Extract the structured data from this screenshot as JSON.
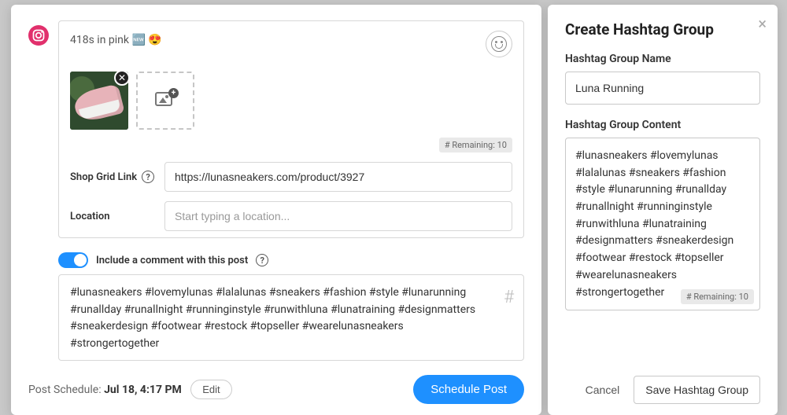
{
  "compose": {
    "caption_text": "418s in pink 🆕  😍",
    "media_remaining": "# Remaining: 10",
    "shop_grid_label": "Shop Grid Link",
    "shop_grid_value": "https://lunasneakers.com/product/3927",
    "location_label": "Location",
    "location_placeholder": "Start typing a location...",
    "include_comment_label": "Include a comment with this post",
    "comment_text": "#lunasneakers #lovemylunas #lalalunas #sneakers #fashion #style #lunarunning #runallday #runallnight #runninginstyle #runwithluna #lunatraining #designmatters #sneakerdesign #footwear #restock #topseller #wearelunasneakers #strongertogether"
  },
  "footer": {
    "schedule_prefix": "Post Schedule: ",
    "schedule_time": "Jul 18, 4:17 PM",
    "edit_label": "Edit",
    "schedule_button": "Schedule Post"
  },
  "hashtag_panel": {
    "title": "Create Hashtag Group",
    "name_label": "Hashtag Group Name",
    "name_value": "Luna Running",
    "content_label": "Hashtag Group Content",
    "content_value": "#lunasneakers #lovemylunas #lalalunas #sneakers #fashion #style #lunarunning #runallday #runallnight #runninginstyle #runwithluna #lunatraining #designmatters #sneakerdesign #footwear #restock #topseller #wearelunasneakers #strongertogether",
    "remaining": "# Remaining: 10",
    "cancel_label": "Cancel",
    "save_label": "Save Hashtag Group"
  }
}
